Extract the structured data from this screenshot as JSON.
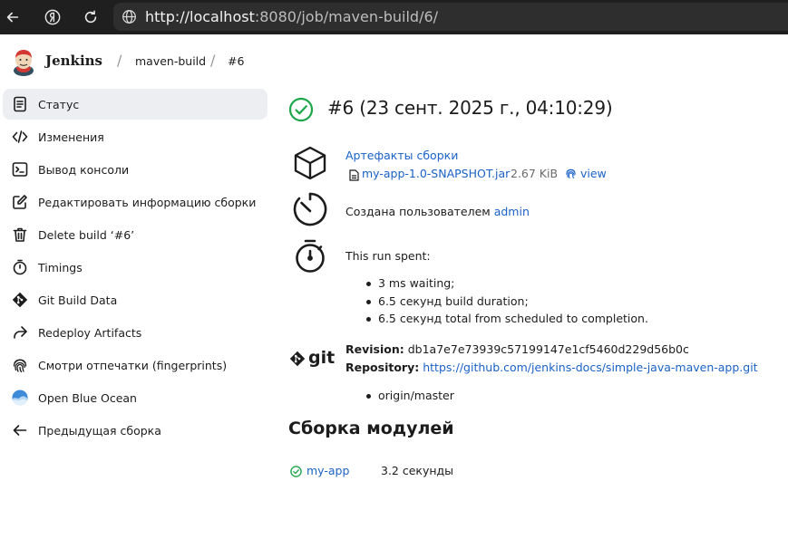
{
  "browser": {
    "url_host": "http://localhost",
    "url_rest": ":8080/job/maven-build/6/"
  },
  "header": {
    "brand": "Jenkins",
    "breadcrumbs": [
      "maven-build",
      "#6"
    ]
  },
  "sidebar": {
    "items": [
      {
        "label": "Статус",
        "icon": "document-icon"
      },
      {
        "label": "Изменения",
        "icon": "code-icon"
      },
      {
        "label": "Вывод консоли",
        "icon": "terminal-icon"
      },
      {
        "label": "Редактировать информацию сборки",
        "icon": "edit-icon"
      },
      {
        "label": "Delete build ‘#6’",
        "icon": "trash-icon"
      },
      {
        "label": "Timings",
        "icon": "stopwatch-icon"
      },
      {
        "label": "Git Build Data",
        "icon": "git-icon"
      },
      {
        "label": "Redeploy Artifacts",
        "icon": "share-icon"
      },
      {
        "label": "Смотри отпечатки (fingerprints)",
        "icon": "fingerprint-icon"
      },
      {
        "label": "Open Blue Ocean",
        "icon": "blue-ocean-icon"
      },
      {
        "label": "Предыдущая сборка",
        "icon": "arrow-left-icon"
      }
    ]
  },
  "main": {
    "title": "#6 (23 сент. 2025 г., 04:10:29)",
    "artifacts": {
      "heading": "Артефакты сборки",
      "file": "my-app-1.0-SNAPSHOT.jar",
      "size": "2.67 KiB",
      "view": "view"
    },
    "created": {
      "prefix": "Создана пользователем",
      "user": "admin"
    },
    "timing": {
      "heading": "This run spent:",
      "items": [
        "3 ms waiting;",
        "6.5 секунд build duration;",
        "6.5 секунд total from scheduled to completion."
      ]
    },
    "git": {
      "revision_label": "Revision",
      "revision": "db1a7e7e73939c57199147e1cf5460d229d56b0c",
      "repository_label": "Repository",
      "repository": "https://github.com/jenkins-docs/simple-java-maven-app.git",
      "branches": [
        "origin/master"
      ],
      "logo_text": "git"
    },
    "modules": {
      "heading": "Сборка модулей",
      "rows": [
        {
          "name": "my-app",
          "duration": "3.2 секунды"
        }
      ]
    }
  },
  "colors": {
    "success": "#1ea64b",
    "link": "#1a62c7",
    "active_bg": "#eceef1",
    "browser_bg": "#1f1f1f"
  }
}
